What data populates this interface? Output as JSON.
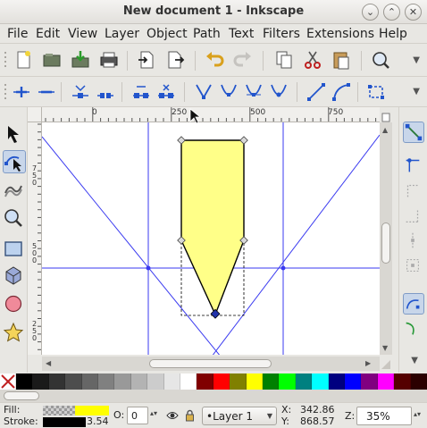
{
  "window": {
    "title": "New document 1 - Inkscape",
    "controls": {
      "minimize": "⌄",
      "maximize": "⌃",
      "close": "✕"
    }
  },
  "menubar": {
    "items": [
      "File",
      "Edit",
      "View",
      "Layer",
      "Object",
      "Path",
      "Text",
      "Filters",
      "Extensions",
      "Help"
    ]
  },
  "toolbar_commands": {
    "icons": [
      "new-document-icon",
      "open-file-icon",
      "import-icon",
      "print-icon",
      "export-icon",
      "export-bitmap-icon",
      "undo-icon",
      "redo-icon",
      "copy-icon",
      "cut-icon",
      "paste-icon",
      "zoom-icon"
    ]
  },
  "toolbar_node": {
    "icons": [
      "insert-node-icon",
      "delete-node-icon",
      "join-nodes-icon",
      "break-path-icon",
      "join-segment-icon",
      "delete-segment-icon",
      "cusp-node-icon",
      "smooth-node-icon",
      "symmetric-node-icon",
      "auto-smooth-node-icon",
      "straight-segment-icon",
      "curve-segment-icon",
      "object-to-path-icon"
    ]
  },
  "ruler": {
    "horizontal_labels": [
      "0",
      "250",
      "500",
      "750"
    ],
    "vertical_labels": [
      "750",
      "500",
      "250"
    ]
  },
  "canvas": {
    "guide_color": "#3a3af0",
    "shape_fill": "#ffff88",
    "shape_stroke": "#000000"
  },
  "palette": {
    "colors": [
      "#000000",
      "#1a1a1a",
      "#333333",
      "#4d4d4d",
      "#666666",
      "#808080",
      "#999999",
      "#b3b3b3",
      "#cccccc",
      "#e6e6e6",
      "#ffffff",
      "#800000",
      "#ff0000",
      "#808000",
      "#ffff00",
      "#008000",
      "#00ff00",
      "#008080",
      "#00ffff",
      "#000080",
      "#0000ff",
      "#800080",
      "#ff00ff",
      "#550000",
      "#2b0000"
    ]
  },
  "status": {
    "fill_label": "Fill:",
    "stroke_label": "Stroke:",
    "stroke_width": "3.54",
    "opacity_label": "O:",
    "opacity_value": "0",
    "layer_name": "•Layer 1",
    "x_label": "X:",
    "x_value": "342.86",
    "y_label": "Y:",
    "y_value": "868.57",
    "zoom_label": "Z:",
    "zoom_value": "35%",
    "fill_color": "#ffff00",
    "stroke_color": "#000000"
  }
}
